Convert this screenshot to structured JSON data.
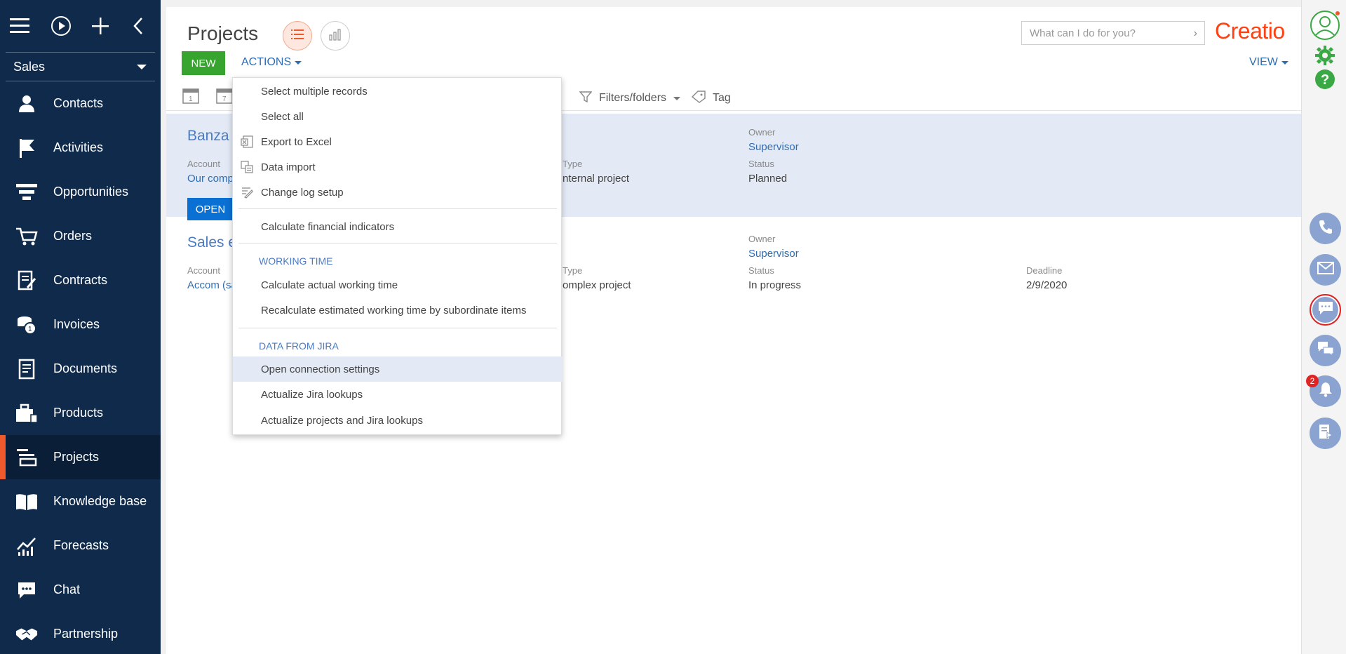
{
  "sidebar": {
    "workspace": "Sales",
    "items": [
      {
        "label": "Contacts",
        "icon": "person-icon"
      },
      {
        "label": "Activities",
        "icon": "flag-icon"
      },
      {
        "label": "Opportunities",
        "icon": "funnel-icon"
      },
      {
        "label": "Orders",
        "icon": "cart-icon"
      },
      {
        "label": "Contracts",
        "icon": "contract-icon"
      },
      {
        "label": "Invoices",
        "icon": "coins-icon"
      },
      {
        "label": "Documents",
        "icon": "document-icon"
      },
      {
        "label": "Products",
        "icon": "products-icon"
      },
      {
        "label": "Projects",
        "icon": "projects-icon"
      },
      {
        "label": "Knowledge base",
        "icon": "book-icon"
      },
      {
        "label": "Forecasts",
        "icon": "forecast-icon"
      },
      {
        "label": "Chat",
        "icon": "chat-icon"
      },
      {
        "label": "Partnership",
        "icon": "handshake-icon"
      }
    ]
  },
  "header": {
    "title": "Projects",
    "search_placeholder": "What can I do for you?",
    "logo": "Creatio",
    "new_label": "NEW",
    "actions_label": "ACTIONS",
    "view_label": "VIEW",
    "filters_label": "Filters/folders",
    "tag_label": "Tag",
    "cal1": "1",
    "cal2": "7"
  },
  "records": [
    {
      "title": "Banza",
      "account_label": "Account",
      "account": "Our comp",
      "type_label": "Type",
      "type": "nternal project",
      "owner_label": "Owner",
      "owner": "Supervisor",
      "status_label": "Status",
      "status": "Planned",
      "open_label": "OPEN"
    },
    {
      "title": "Sales e",
      "account_label": "Account",
      "account": "Accom (sa",
      "type_label": "Type",
      "type": "omplex project",
      "owner_label": "Owner",
      "owner": "Supervisor",
      "status_label": "Status",
      "status": "In progress",
      "deadline_label": "Deadline",
      "deadline": "2/9/2020"
    }
  ],
  "menu": {
    "items1": [
      "Select multiple records",
      "Select all",
      "Export to Excel",
      "Data import",
      "Change log setup"
    ],
    "items2": [
      "Calculate financial indicators"
    ],
    "working_time_header": "WORKING TIME",
    "items3": [
      "Calculate actual working time",
      "Recalculate estimated working time by subordinate items"
    ],
    "jira_header": "DATA FROM JIRA",
    "items4": [
      "Open connection settings",
      "Actualize Jira lookups",
      "Actualize projects and Jira lookups"
    ]
  },
  "rail": {
    "notification_count": "2"
  },
  "colors": {
    "sidebar_bg": "#0f2a4a",
    "accent": "#ee5a2c",
    "link": "#2e6db4",
    "new_button": "#36a42f"
  }
}
